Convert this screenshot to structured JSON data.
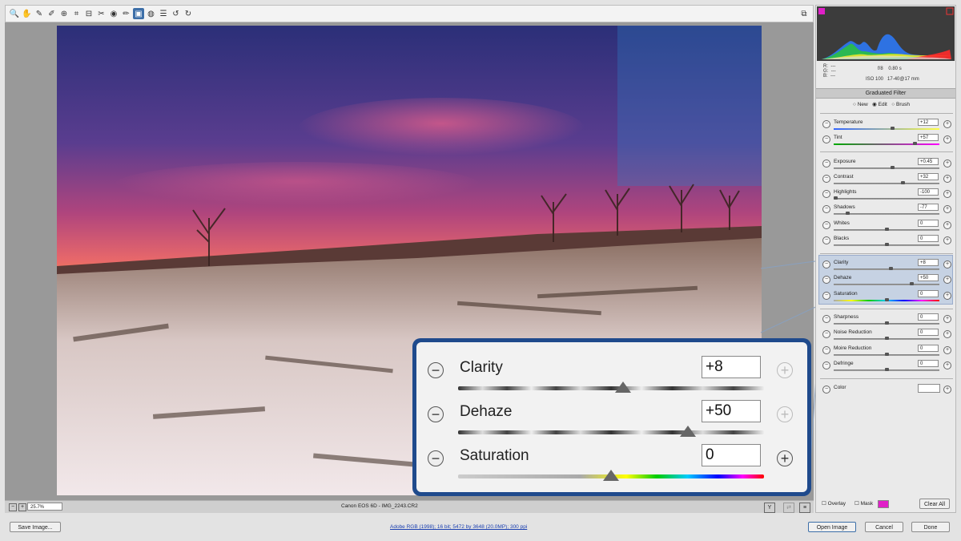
{
  "toolbar": {
    "tools": [
      "zoom-icon",
      "hand-icon",
      "white-balance-icon",
      "color-sampler-icon",
      "target-adjust-icon",
      "crop-icon",
      "straighten-icon",
      "spot-removal-icon",
      "red-eye-icon",
      "adjustment-brush-icon",
      "graduated-filter-icon",
      "radial-filter-icon",
      "preferences-icon",
      "rotate-left-icon",
      "rotate-right-icon"
    ],
    "selected_tool": "graduated-filter-icon"
  },
  "info": {
    "r_label": "R:",
    "r_value": "---",
    "g_label": "G:",
    "g_value": "---",
    "b_label": "B:",
    "b_value": "---",
    "aperture": "f/8",
    "shutter": "0.80 s",
    "iso": "ISO 100",
    "lens": "17-40@17 mm"
  },
  "panel": {
    "title": "Graduated Filter",
    "modes": [
      "New",
      "Edit",
      "Brush"
    ],
    "selected_mode": "Edit",
    "sliders": [
      {
        "label": "Temperature",
        "value": "+12",
        "pos": 0.56
      },
      {
        "label": "Tint",
        "value": "+57",
        "pos": 0.78
      },
      {
        "label": "Exposure",
        "value": "+0.45",
        "pos": 0.56
      },
      {
        "label": "Contrast",
        "value": "+32",
        "pos": 0.66
      },
      {
        "label": "Highlights",
        "value": "-100",
        "pos": 0.0
      },
      {
        "label": "Shadows",
        "value": "-77",
        "pos": 0.12
      },
      {
        "label": "Whites",
        "value": "0",
        "pos": 0.5
      },
      {
        "label": "Blacks",
        "value": "0",
        "pos": 0.5
      },
      {
        "label": "Clarity",
        "value": "+8",
        "pos": 0.54
      },
      {
        "label": "Dehaze",
        "value": "+50",
        "pos": 0.75
      },
      {
        "label": "Saturation",
        "value": "0",
        "pos": 0.5
      },
      {
        "label": "Sharpness",
        "value": "0",
        "pos": 0.5
      },
      {
        "label": "Noise Reduction",
        "value": "0",
        "pos": 0.5
      },
      {
        "label": "Moire Reduction",
        "value": "0",
        "pos": 0.5
      },
      {
        "label": "Defringe",
        "value": "0",
        "pos": 0.5
      }
    ],
    "color_label": "Color",
    "overlay_label": "Overlay",
    "mask_label": "Mask",
    "clear_all_label": "Clear All"
  },
  "callout": {
    "rows": [
      {
        "label": "Clarity",
        "value": "+8",
        "pos": 0.54
      },
      {
        "label": "Dehaze",
        "value": "+50",
        "pos": 0.75
      },
      {
        "label": "Saturation",
        "value": "0",
        "pos": 0.5
      }
    ]
  },
  "status": {
    "zoom": "25.7%",
    "filename": "Canon EOS 6D  -  IMG_2243.CR2"
  },
  "bottom": {
    "save_label": "Save Image...",
    "workflow_link": "Adobe RGB (1998); 16 bit; 5472 by 3648 (20.0MP); 300 ppi",
    "open_label": "Open Image",
    "cancel_label": "Cancel",
    "done_label": "Done"
  },
  "colors": {
    "accent": "#1f4a8c",
    "mask_color": "#e020c8"
  }
}
